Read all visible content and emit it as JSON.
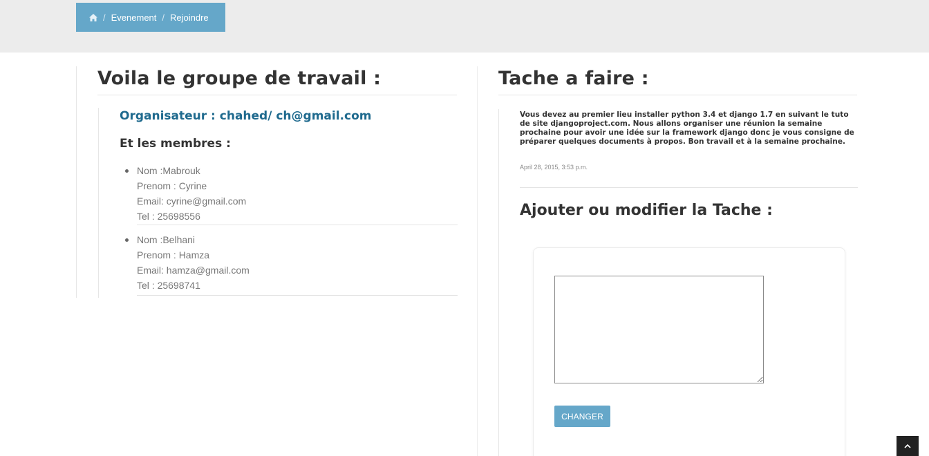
{
  "breadcrumb": {
    "home_icon": "home-icon",
    "separator": "/",
    "items": [
      "Evenement",
      "Rejoindre"
    ]
  },
  "left": {
    "title": "Voila le groupe de travail :",
    "organiser": "Organisateur : chahed/ ch@gmail.com",
    "members_title": "Et les membres :",
    "members": [
      {
        "nom": "Nom :Mabrouk",
        "prenom": "Prenom : Cyrine",
        "email": "Email: cyrine@gmail.com",
        "tel": "Tel : 25698556"
      },
      {
        "nom": "Nom :Belhani",
        "prenom": "Prenom : Hamza",
        "email": "Email: hamza@gmail.com",
        "tel": "Tel : 25698741"
      }
    ]
  },
  "right": {
    "title": "Tache a faire :",
    "task_text": "Vous devez au premier lieu installer python 3.4 et django 1.7 en suivant le tuto de site djangoproject.com. Nous allons organiser une réunion la semaine prochaine pour avoir une idée sur la framework django donc je vous consigne de préparer quelques documents à propos. Bon travail et à la semaine prochaine.",
    "task_date": "April 28, 2015, 3:53 p.m.",
    "add_title": "Ajouter ou modifier la Tache :",
    "textarea_value": "",
    "button_label": "CHANGER"
  },
  "scroll_top": {
    "icon": "chevron-up-icon"
  },
  "colors": {
    "accent": "#65a7c9",
    "organiser": "#1f6a8e",
    "top_band": "#ececec"
  }
}
